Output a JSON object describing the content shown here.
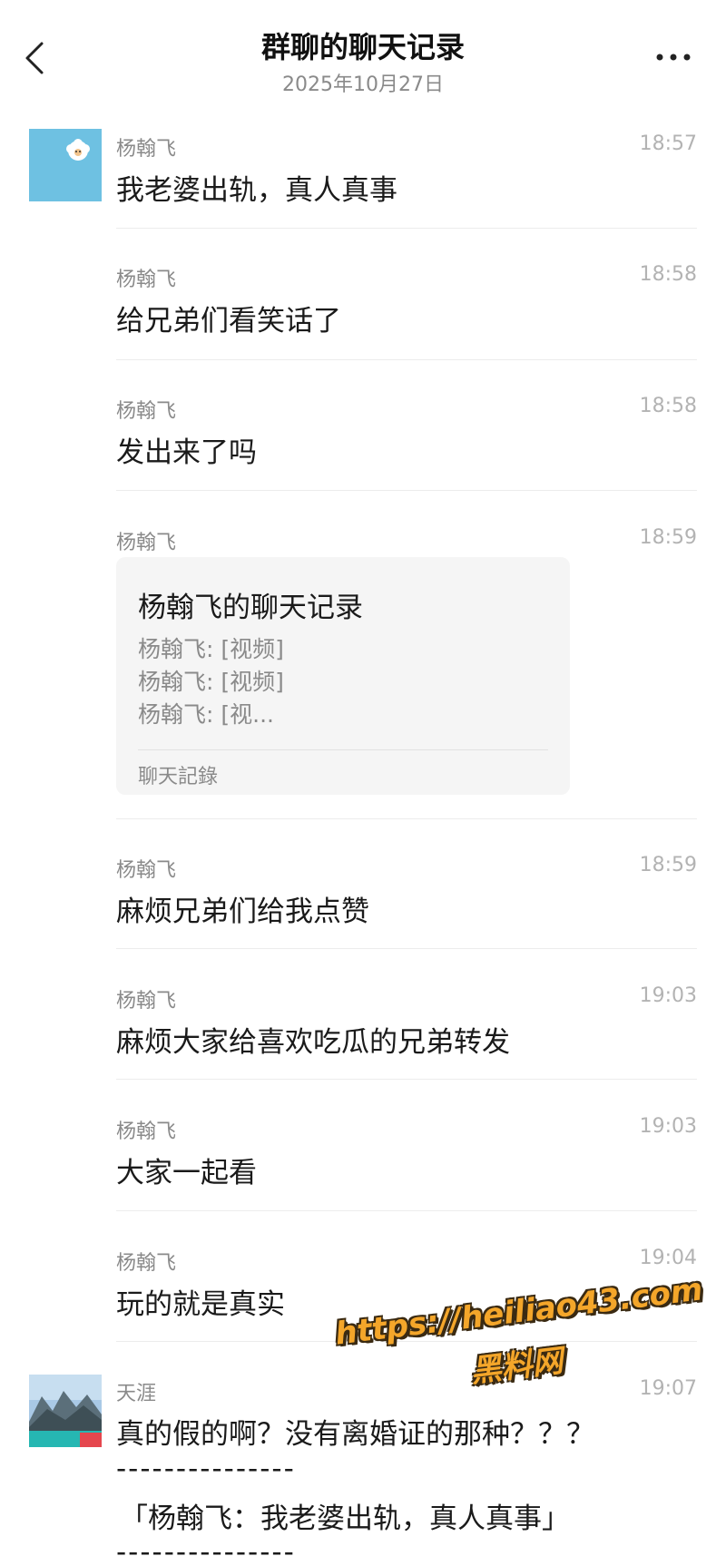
{
  "header": {
    "title": "群聊的聊天记录",
    "date": "2025年10月27日"
  },
  "messages": [
    {
      "sender": "杨翰飞",
      "time": "18:57",
      "text": "我老婆出轨，真人真事"
    },
    {
      "sender": "杨翰飞",
      "time": "18:58",
      "text": "给兄弟们看笑话了"
    },
    {
      "sender": "杨翰飞",
      "time": "18:58",
      "text": "发出来了吗"
    },
    {
      "sender": "杨翰飞",
      "time": "18:59"
    },
    {
      "sender": "杨翰飞",
      "time": "18:59",
      "text": "麻烦兄弟们给我点赞"
    },
    {
      "sender": "杨翰飞",
      "time": "19:03",
      "text": "麻烦大家给喜欢吃瓜的兄弟转发"
    },
    {
      "sender": "杨翰飞",
      "time": "19:03",
      "text": "大家一起看"
    },
    {
      "sender": "杨翰飞",
      "time": "19:04",
      "text": "玩的就是真实"
    },
    {
      "sender": "天涯",
      "time": "19:07",
      "text": "真的假的啊？没有离婚证的那种？？？",
      "dashes": "---------------",
      "quote": "「杨翰飞：我老婆出轨，真人真事」"
    }
  ],
  "record_card": {
    "title": "杨翰飞的聊天记录",
    "lines": [
      "杨翰飞: [视频]",
      "杨翰飞: [视频]",
      "杨翰飞: [视..."
    ],
    "footer": "聊天記錄"
  },
  "watermark": {
    "url": "https://heiliao43.com",
    "name": "黑料网"
  },
  "icons": {
    "back": "chevron-left-icon",
    "more": "more-dots-icon"
  }
}
